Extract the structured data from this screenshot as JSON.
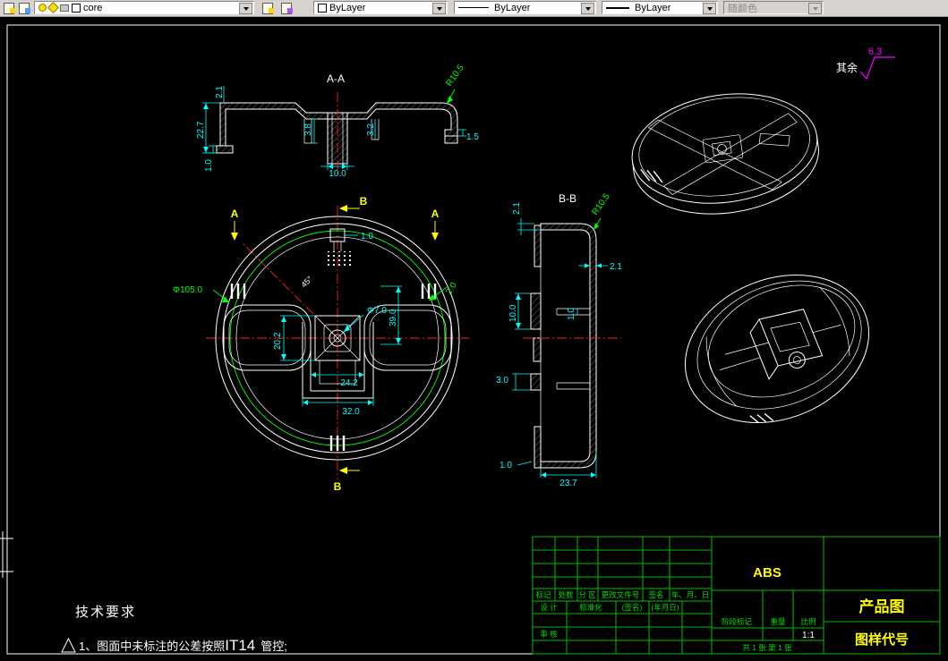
{
  "toolbar": {
    "layer_value": "core",
    "color_value": "ByLayer",
    "linetype_value": "ByLayer",
    "lineweight_value": "ByLayer",
    "plot_style_value": "随颜色"
  },
  "colors": {
    "geometry": "#ffffff",
    "dimension": "#00ffff",
    "radial_dimension": "#00ff00",
    "centerline": "#ff2020",
    "section_marker": "#ffff00",
    "finish_symbol": "#ff00ff",
    "table_lines": "#00c000",
    "highlight_text": "#ffff00"
  },
  "surface_finish": {
    "prefix": "其余",
    "roughness": "6.3"
  },
  "section_aa": {
    "label": "A-A",
    "dim_notch": "2.1",
    "dim_height": "22.7",
    "dim_foot": "1.0",
    "dim_rib_left": "3.8",
    "dim_boss_width": "10.0",
    "dim_rib_right": "3.2",
    "dim_step": "1.5",
    "dim_radius": "R10.5"
  },
  "top_view": {
    "marker_a": "A",
    "marker_b": "B",
    "dim_diameter": "Φ105.0",
    "dim_angle": "45°",
    "dim_hole": "Φ7.0",
    "dim_length": "39.0",
    "dim_square": "20.2",
    "dim_inner_width": "24.2",
    "dim_outer_width": "32.0",
    "dim_clip": "1.0",
    "dim_rim": "2.0"
  },
  "section_bb": {
    "label": "B-B",
    "dim_radius": "R10.5",
    "dim_top_wall": "2.1",
    "dim_side_wall": "2.1",
    "dim_boss": "10.0",
    "dim_rib": "1.0",
    "dim_step": "3.0",
    "dim_foot": "1.0",
    "dim_depth": "23.7"
  },
  "tech_req": {
    "title": "技术要求",
    "item_prefix": "1、图面中未标注的公差按照",
    "item_code": "IT14",
    "item_suffix": "管控;"
  },
  "title_block": {
    "material": "ABS",
    "drawing_name": "产品图",
    "drawing_code": "图样代号",
    "col_mark": "标记",
    "col_count": "处数",
    "col_zone": "分 区",
    "col_file_no": "更改文件号",
    "col_sign": "签名",
    "col_date": "年、月、日",
    "row_design": "设 计",
    "row_standardize": "标准化",
    "hint_sign": "(签名)",
    "hint_date": "(年月日)",
    "row_check": "审 核",
    "label_stage": "阶段标记",
    "label_weight": "重量",
    "label_scale": "比例",
    "scale_value": "1:1",
    "sheet_info": "共 1 张 第 1 张"
  }
}
